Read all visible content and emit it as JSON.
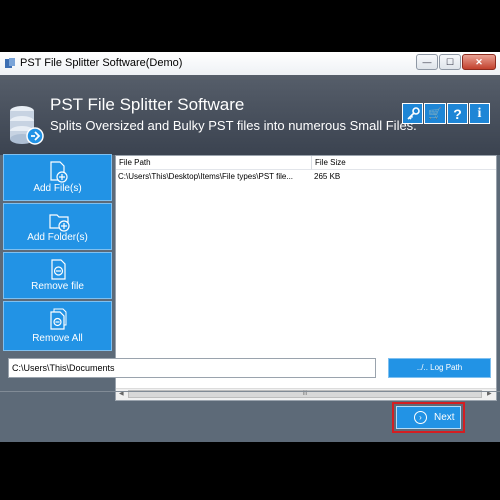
{
  "window": {
    "title": "PST File Splitter Software(Demo)"
  },
  "title_controls": {
    "minimize": "—",
    "maximize": "☐",
    "close": "✕"
  },
  "header": {
    "title": "PST File Splitter Software",
    "subtitle": "Splits Oversized and Bulky PST files into numerous Small Files.",
    "buttons": [
      {
        "icon": "key-icon"
      },
      {
        "icon": "cart-icon",
        "label": "🛒"
      },
      {
        "icon": "help-icon",
        "label": "?"
      },
      {
        "icon": "info-icon",
        "label": "i"
      }
    ]
  },
  "sidebar": {
    "items": [
      {
        "label": "Add File(s)",
        "icon": "add-file-icon"
      },
      {
        "label": "Add Folder(s)",
        "icon": "add-folder-icon"
      },
      {
        "label": "Remove file",
        "icon": "remove-file-icon"
      },
      {
        "label": "Remove All",
        "icon": "remove-all-icon"
      }
    ]
  },
  "file_list": {
    "columns": [
      "File Path",
      "File Size"
    ],
    "rows": [
      {
        "path": "C:\\Users\\This\\Desktop\\Items\\File types\\PST file...",
        "size": "265 KB"
      }
    ],
    "scroll_thumb": "III"
  },
  "output": {
    "path_value": "C:\\Users\\This\\Documents",
    "log_path_label": "../.. Log Path"
  },
  "footer": {
    "next_label": "Next"
  },
  "colors": {
    "accent": "#2293e5",
    "header_bg": "#454d59",
    "panel_bg": "#5d6a78",
    "highlight_border": "#d41e22"
  }
}
